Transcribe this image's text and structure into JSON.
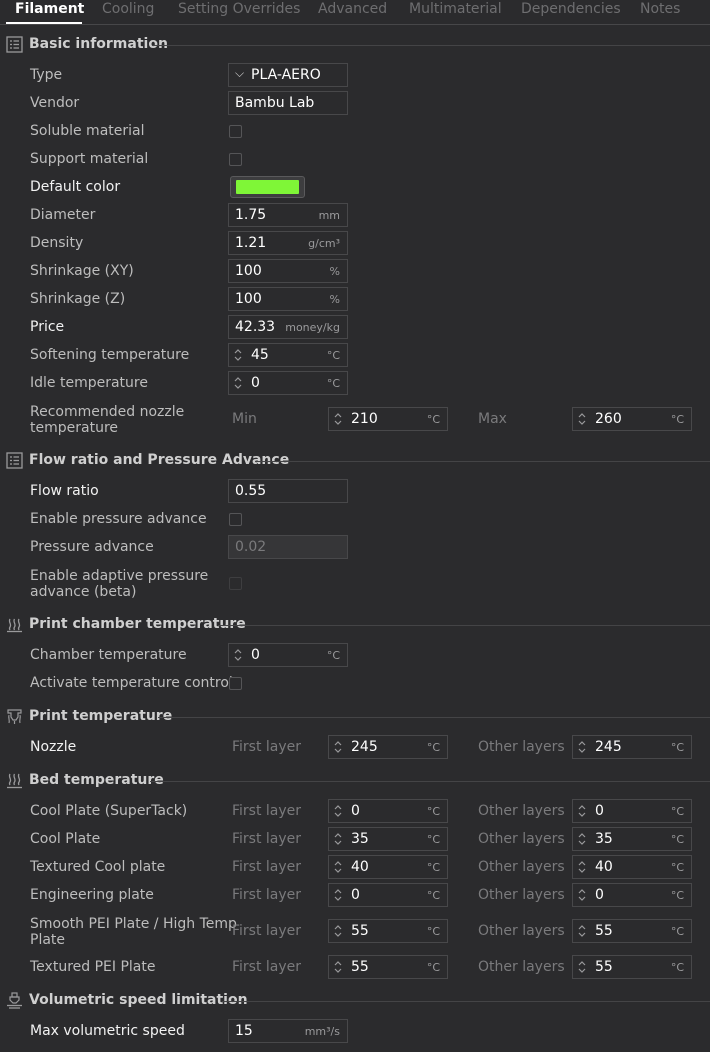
{
  "tabs": [
    {
      "label": "Filament",
      "active": true
    },
    {
      "label": "Cooling"
    },
    {
      "label": "Setting Overrides"
    },
    {
      "label": "Advanced"
    },
    {
      "label": "Multimaterial"
    },
    {
      "label": "Dependencies"
    },
    {
      "label": "Notes"
    }
  ],
  "sections": {
    "basic": "Basic information",
    "flow": "Flow ratio and Pressure Advance",
    "chamber": "Print chamber temperature",
    "print_temp": "Print temperature",
    "bed_temp": "Bed temperature",
    "volumetric": "Volumetric speed limitation"
  },
  "basic": {
    "type": {
      "label": "Type",
      "value": "PLA-AERO"
    },
    "vendor": {
      "label": "Vendor",
      "value": "Bambu Lab"
    },
    "soluble": {
      "label": "Soluble material",
      "checked": false
    },
    "support": {
      "label": "Support material",
      "checked": false
    },
    "default_color": {
      "label": "Default color",
      "color": "#7ff637"
    },
    "diameter": {
      "label": "Diameter",
      "value": "1.75",
      "unit": "mm"
    },
    "density": {
      "label": "Density",
      "value": "1.21",
      "unit": "g/cm³"
    },
    "shrink_xy": {
      "label": "Shrinkage (XY)",
      "value": "100",
      "unit": "%"
    },
    "shrink_z": {
      "label": "Shrinkage (Z)",
      "value": "100",
      "unit": "%"
    },
    "price": {
      "label": "Price",
      "value": "42.33",
      "unit": "money/kg"
    },
    "softening": {
      "label": "Softening temperature",
      "value": "45",
      "unit": "°C"
    },
    "idle": {
      "label": "Idle temperature",
      "value": "0",
      "unit": "°C"
    },
    "nozzle_rec": {
      "label_line1": "Recommended nozzle",
      "label_line2": "temperature",
      "min_label": "Min",
      "min": "210",
      "max_label": "Max",
      "max": "260",
      "unit": "°C"
    }
  },
  "flow": {
    "flow_ratio": {
      "label": "Flow ratio",
      "value": "0.55"
    },
    "enable_pa": {
      "label": "Enable pressure advance",
      "checked": false
    },
    "pa": {
      "label": "Pressure advance",
      "value": "0.02"
    },
    "adaptive_pa": {
      "label_line1": "Enable adaptive pressure",
      "label_line2": "advance (beta)",
      "checked": false
    }
  },
  "chamber": {
    "temp": {
      "label": "Chamber temperature",
      "value": "0",
      "unit": "°C"
    },
    "control": {
      "label": "Activate temperature control",
      "checked": false
    }
  },
  "layer_labels": {
    "first": "First layer",
    "other": "Other layers"
  },
  "print_temp": {
    "nozzle": {
      "label": "Nozzle",
      "first": "245",
      "other": "245",
      "unit": "°C"
    }
  },
  "bed": [
    {
      "label": "Cool Plate (SuperTack)",
      "first": "0",
      "other": "0",
      "unit": "°C"
    },
    {
      "label": "Cool Plate",
      "first": "35",
      "other": "35",
      "unit": "°C"
    },
    {
      "label": "Textured Cool plate",
      "first": "40",
      "other": "40",
      "unit": "°C"
    },
    {
      "label": "Engineering plate",
      "first": "0",
      "other": "0",
      "unit": "°C"
    },
    {
      "label_line1": "Smooth PEI Plate / High Temp",
      "label_line2": "Plate",
      "first": "55",
      "other": "55",
      "unit": "°C"
    },
    {
      "label": "Textured PEI Plate",
      "first": "55",
      "other": "55",
      "unit": "°C"
    }
  ],
  "volumetric": {
    "max_speed": {
      "label": "Max volumetric speed",
      "value": "15",
      "unit": "mm³/s"
    }
  },
  "icons": {
    "list": "list-icon",
    "heat": "heat-waves-icon",
    "nozzle": "nozzle-icon",
    "volumetric": "extruder-icon"
  }
}
